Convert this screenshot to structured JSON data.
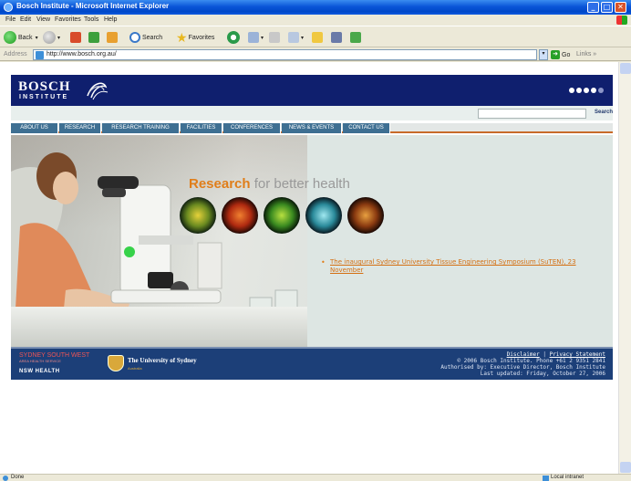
{
  "window": {
    "title": "Bosch Institute - Microsoft Internet Explorer",
    "minimize": "_",
    "maximize": "□",
    "close": "✕"
  },
  "menu": [
    "File",
    "Edit",
    "View",
    "Favorites",
    "Tools",
    "Help"
  ],
  "toolbar": {
    "back_label": "Back",
    "search_label": "Search",
    "favorites_label": "Favorites"
  },
  "address": {
    "label": "Address",
    "url": "http://www.bosch.org.au/",
    "go_label": "Go",
    "links_label": "Links"
  },
  "site": {
    "logo_main": "BOSCH",
    "logo_sub": "INSTITUTE",
    "search_button": "Search",
    "nav": [
      "ABOUT US",
      "RESEARCH",
      "RESEARCH TRAINING",
      "FACILITIES",
      "CONFERENCES",
      "NEWS & EVENTS",
      "CONTACT US"
    ],
    "slogan_highlight": "Research",
    "slogan_rest": " for better health",
    "news_item": "The inaugural Sydney University Tissue Engineering Symposium (SuTEN), 23 November",
    "footer": {
      "sswahs_name": "SYDNEY SOUTH WEST",
      "sswahs_sub": "AREA HEALTH SERVICE",
      "nsw_health": "NSW HEALTH",
      "usyd_name": "The University of Sydney",
      "usyd_sub": "Australia",
      "disclaimer": "Disclaimer",
      "privacy": "Privacy Statement",
      "copyright": "© 2006 Bosch Institute. Phone +61 2 9351 2841",
      "authorised": "Authorised by: Executive Director, Bosch Institute",
      "updated": "Last updated: Friday, October 27, 2006"
    }
  },
  "status": {
    "text": "Done",
    "zone": "Local intranet"
  },
  "colors": {
    "header_navy": "#0f1f6e",
    "nav_blue": "#3e6f92",
    "accent_orange": "#e07e1a",
    "footer_blue": "#1c3f78"
  }
}
